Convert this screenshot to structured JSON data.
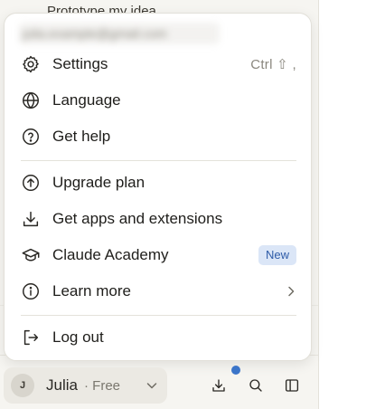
{
  "background": {
    "recent_item": "Prototype my idea"
  },
  "menu": {
    "email": "julia.example@gmail.com",
    "items": [
      {
        "label": "Settings",
        "icon": "gear-icon",
        "shortcut": "Ctrl ⇧ ,"
      },
      {
        "label": "Language",
        "icon": "globe-icon"
      },
      {
        "label": "Get help",
        "icon": "help-circle-icon"
      },
      {
        "label": "Upgrade plan",
        "icon": "upgrade-arrow-icon"
      },
      {
        "label": "Get apps and extensions",
        "icon": "download-icon"
      },
      {
        "label": "Claude Academy",
        "icon": "graduation-cap-icon",
        "badge": "New"
      },
      {
        "label": "Learn more",
        "icon": "info-icon"
      },
      {
        "label": "Log out",
        "icon": "logout-icon"
      }
    ]
  },
  "user": {
    "initial": "J",
    "name": "Julia",
    "plan": "· Free"
  },
  "colors": {
    "accent_badge_bg": "#dbe6f7",
    "accent_badge_text": "#2f5ca8",
    "notification_dot": "#3b75c9"
  }
}
